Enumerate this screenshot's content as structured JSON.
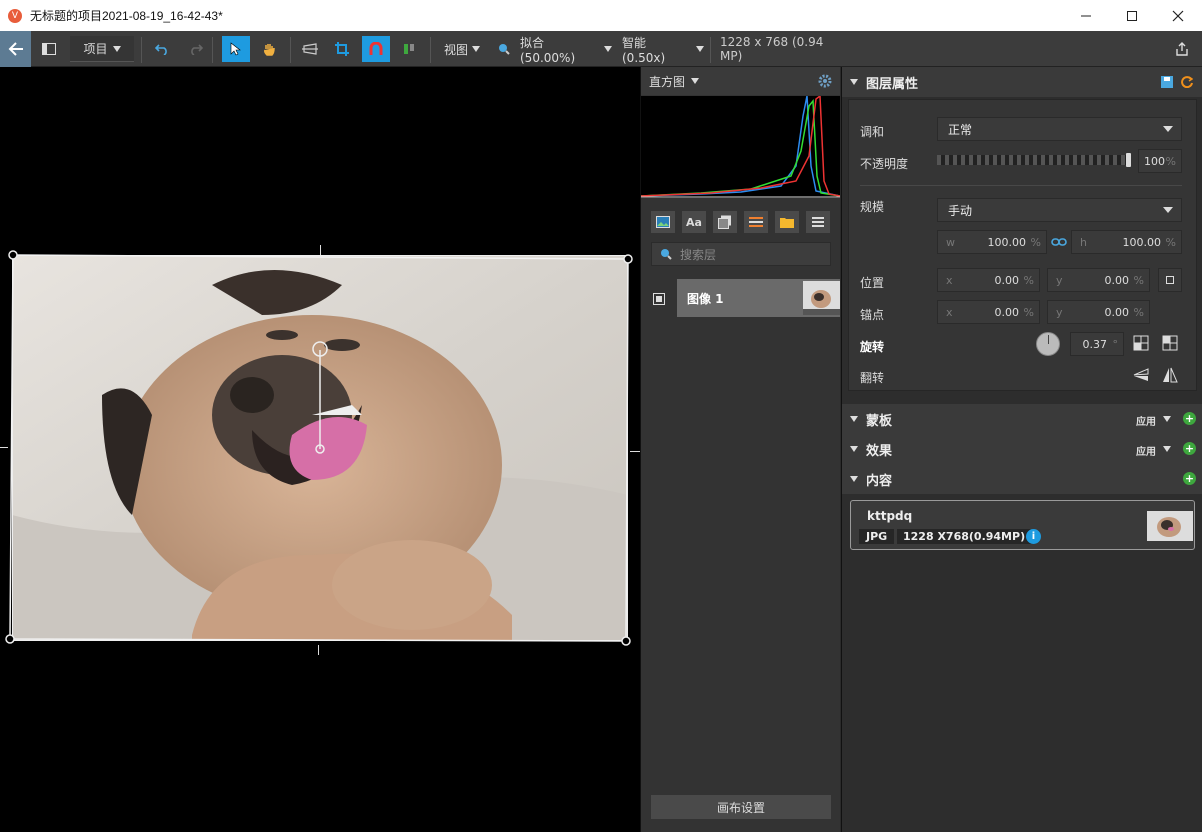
{
  "window": {
    "title": "无标题的项目2021-08-19_16-42-43*",
    "app_icon": "V"
  },
  "toolbar": {
    "project_label": "项目",
    "view_label": "视图",
    "fit_label": "拟合 (50.00%)",
    "smart_label": "智能 (0.50x)",
    "image_info": "1228 x 768 (0.94 MP)"
  },
  "histogram": {
    "title": "直方图"
  },
  "layers": {
    "search_placeholder": "搜索层",
    "items": [
      {
        "name": "图像 1"
      }
    ],
    "canvas_settings_label": "画布设置"
  },
  "props": {
    "title": "图层属性",
    "blend_label": "调和",
    "blend_value": "正常",
    "opacity_label": "不透明度",
    "opacity_value": "100",
    "opacity_unit": "%",
    "scale_label": "规模",
    "scale_mode": "手动",
    "w_label": "w",
    "w_value": "100.00",
    "h_label": "h",
    "h_value": "100.00",
    "percent": "%",
    "position_label": "位置",
    "pos_x_label": "x",
    "pos_x": "0.00",
    "pos_y_label": "y",
    "pos_y": "0.00",
    "anchor_label": "锚点",
    "anchor_x_label": "x",
    "anchor_x": "0.00",
    "anchor_y_label": "y",
    "anchor_y": "0.00",
    "rotate_label": "旋转",
    "rotate_value": "0.37",
    "rotate_unit": "°",
    "flip_label": "翻转"
  },
  "sections": {
    "mask": "蒙板",
    "effects": "效果",
    "content": "内容",
    "apply": "应用"
  },
  "content_card": {
    "name": "kttpdq",
    "format": "JPG",
    "dimensions": "1228 X768(0.94MP)"
  },
  "colors": {
    "accent": "#1e9be0",
    "add_green": "#3ea83e",
    "orange": "#f0901c"
  }
}
